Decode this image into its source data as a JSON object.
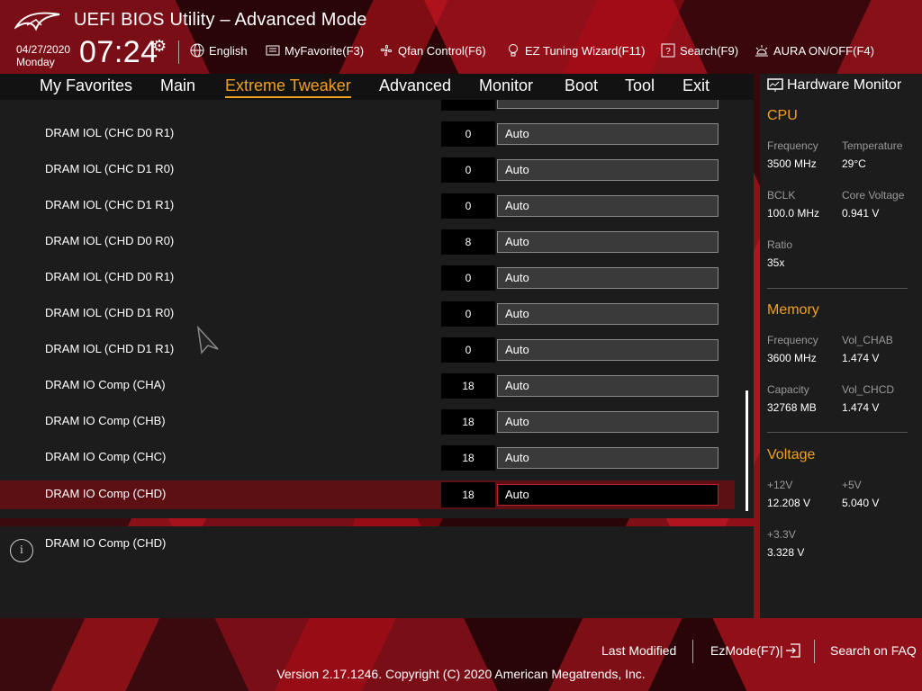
{
  "header": {
    "title": "UEFI BIOS Utility – Advanced Mode",
    "date": "04/27/2020",
    "day": "Monday",
    "time": "07:24",
    "tools": {
      "language": "English",
      "favorite": "MyFavorite(F3)",
      "qfan": "Qfan Control(F6)",
      "ez_tuning": "EZ Tuning Wizard(F11)",
      "search": "Search(F9)",
      "aura": "AURA ON/OFF(F4)"
    }
  },
  "nav": {
    "tabs": [
      "My Favorites",
      "Main",
      "Extreme Tweaker",
      "Advanced",
      "Monitor",
      "Boot",
      "Tool",
      "Exit"
    ],
    "active": "Extreme Tweaker"
  },
  "settings": {
    "rows": [
      {
        "label": "DRAM IOL (CHC D0 R1)",
        "value": "0",
        "setting": "Auto"
      },
      {
        "label": "DRAM IOL (CHC D1 R0)",
        "value": "0",
        "setting": "Auto"
      },
      {
        "label": "DRAM IOL (CHC D1 R1)",
        "value": "0",
        "setting": "Auto"
      },
      {
        "label": "DRAM IOL (CHD D0 R0)",
        "value": "8",
        "setting": "Auto"
      },
      {
        "label": "DRAM IOL (CHD D0 R1)",
        "value": "0",
        "setting": "Auto"
      },
      {
        "label": "DRAM IOL (CHD D1 R0)",
        "value": "0",
        "setting": "Auto"
      },
      {
        "label": "DRAM IOL (CHD D1 R1)",
        "value": "0",
        "setting": "Auto"
      },
      {
        "label": "DRAM IO Comp (CHA)",
        "value": "18",
        "setting": "Auto"
      },
      {
        "label": "DRAM IO Comp (CHB)",
        "value": "18",
        "setting": "Auto"
      },
      {
        "label": "DRAM IO Comp (CHC)",
        "value": "18",
        "setting": "Auto"
      },
      {
        "label": "DRAM IO Comp (CHD)",
        "value": "18",
        "setting": "Auto"
      }
    ],
    "selected_label": "DRAM IO Comp (CHD)"
  },
  "help": {
    "text": "DRAM IO Comp (CHD)"
  },
  "hardware_monitor": {
    "title": "Hardware Monitor",
    "cpu": {
      "section": "CPU",
      "frequency_label": "Frequency",
      "frequency": "3500 MHz",
      "temperature_label": "Temperature",
      "temperature": "29°C",
      "bclk_label": "BCLK",
      "bclk": "100.0 MHz",
      "core_voltage_label": "Core Voltage",
      "core_voltage": "0.941 V",
      "ratio_label": "Ratio",
      "ratio": "35x"
    },
    "memory": {
      "section": "Memory",
      "frequency_label": "Frequency",
      "frequency": "3600 MHz",
      "vol_chab_label": "Vol_CHAB",
      "vol_chab": "1.474 V",
      "capacity_label": "Capacity",
      "capacity": "32768 MB",
      "vol_chcd_label": "Vol_CHCD",
      "vol_chcd": "1.474 V"
    },
    "voltage": {
      "section": "Voltage",
      "v12_label": "+12V",
      "v12": "12.208 V",
      "v5_label": "+5V",
      "v5": "5.040 V",
      "v33_label": "+3.3V",
      "v33": "3.328 V"
    }
  },
  "footer": {
    "last_modified": "Last Modified",
    "ezmode": "EzMode(F7)|",
    "search_faq": "Search on FAQ",
    "version": "Version 2.17.1246. Copyright (C) 2020 American Megatrends, Inc."
  },
  "colors": {
    "accent": "#f0a020",
    "selected_row": "#5c1014",
    "panel": "#1c1c1c"
  }
}
